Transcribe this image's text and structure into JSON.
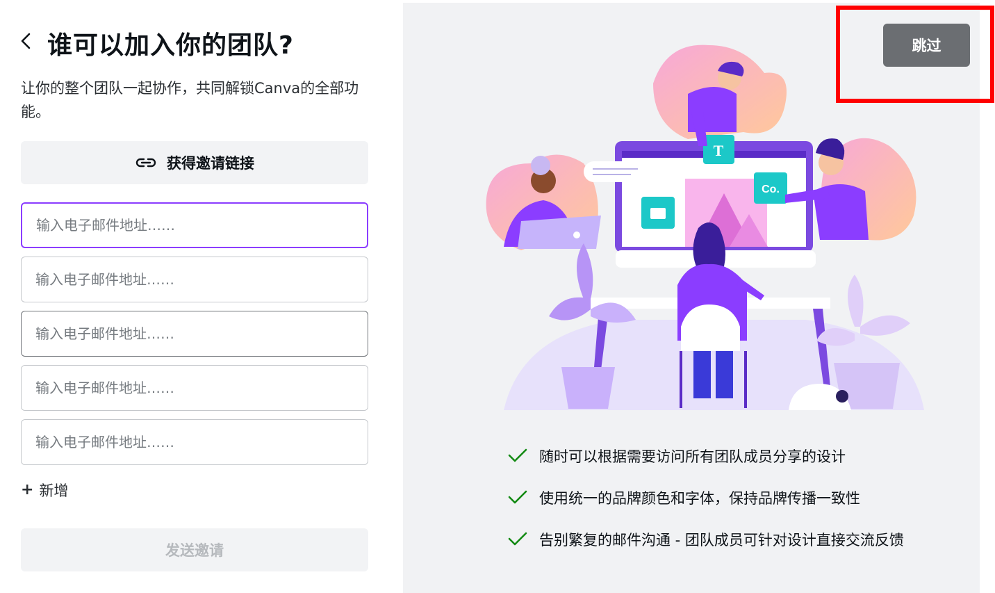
{
  "header": {
    "title": "谁可以加入你的团队?",
    "subtitle": "让你的整个团队一起协作，共同解锁Canva的全部功能。"
  },
  "invite_link": {
    "label": "获得邀请链接"
  },
  "email_fields": [
    {
      "placeholder": "输入电子邮件地址……"
    },
    {
      "placeholder": "输入电子邮件地址……"
    },
    {
      "placeholder": "输入电子邮件地址……"
    },
    {
      "placeholder": "输入电子邮件地址……"
    },
    {
      "placeholder": "输入电子邮件地址……"
    }
  ],
  "add_more": {
    "label": "新增",
    "icon": "plus-icon"
  },
  "send": {
    "label": "发送邀请"
  },
  "skip": {
    "label": "跳过"
  },
  "illustration": {
    "tile_t": "T",
    "tile_co": "Co."
  },
  "features": [
    {
      "text": "随时可以根据需要访问所有团队成员分享的设计"
    },
    {
      "text": "使用统一的品牌颜色和字体，保持品牌传播一致性"
    },
    {
      "text": "告别繁复的邮件沟通 - 团队成员可针对设计直接交流反馈"
    }
  ],
  "colors": {
    "accent": "#8b3dff",
    "skip_bg": "#6b6e72",
    "check": "#138a13",
    "highlight": "#ff0000"
  }
}
